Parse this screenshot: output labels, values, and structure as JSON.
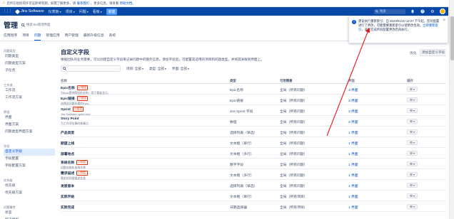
{
  "banner": {
    "text": "您所在组织的许可证即将到期，如需了解更多，请",
    "link1": "联系我们",
    "text2": "。更多信息，请查看",
    "link2": "帮助文档。"
  },
  "nav": {
    "brand": "Jira Software",
    "menus": [
      {
        "label": "仪表板"
      },
      {
        "label": "项目"
      },
      {
        "label": "问题"
      },
      {
        "label": "看板"
      }
    ],
    "create_label": "新建",
    "search_placeholder": "搜索"
  },
  "admin": {
    "title": "管理",
    "search_placeholder": "搜索Jira管理界面",
    "tabs": [
      {
        "label": "应用程序"
      },
      {
        "label": "项目"
      },
      {
        "label": "问题"
      },
      {
        "label": "管理应用"
      },
      {
        "label": "用户管理"
      },
      {
        "label": "最新升级信息"
      },
      {
        "label": "系统"
      }
    ]
  },
  "sidebar": {
    "groups": [
      {
        "heading": "问题类型",
        "items": [
          {
            "label": "问题类型"
          },
          {
            "label": "问题类型方案"
          },
          {
            "label": "子任务"
          }
        ]
      },
      {
        "heading": "工作流",
        "items": [
          {
            "label": "工作流"
          },
          {
            "label": "工作流方案"
          }
        ]
      },
      {
        "heading": "界面",
        "items": [
          {
            "label": "界面"
          },
          {
            "label": "界面方案"
          },
          {
            "label": "问题类型界面方案"
          }
        ]
      },
      {
        "heading": "字段",
        "items": [
          {
            "label": "自定义字段",
            "active": true
          },
          {
            "label": "字段配置"
          },
          {
            "label": "字段配置方案"
          }
        ]
      },
      {
        "heading": "优先级",
        "items": [
          {
            "label": "优先级"
          },
          {
            "label": "优先级方案"
          }
        ]
      },
      {
        "heading": "问题属性",
        "items": [
          {
            "label": "状态"
          },
          {
            "label": "解决结果"
          }
        ]
      }
    ]
  },
  "page": {
    "heading": "自定义字段",
    "description": "根据团队的业务需要，可以创建自定义字段来记录问题中的额外信息。添加字段后，可配置其适用的项目和问题类型，并将其关联到界面上。",
    "optimize_label": "优化",
    "add_label": "添加自定义字段",
    "filters": [
      {
        "label": "项目: 全部"
      },
      {
        "label": "类型: 全部"
      },
      {
        "label": "界面: 全部"
      }
    ]
  },
  "fields": {
    "columns": {
      "name": "名称",
      "type": "类型",
      "context": "可用情景",
      "screens": "界面",
      "actions": "操作"
    },
    "rows": [
      {
        "name": "Epic名称",
        "tag": "已锁定",
        "description": "为Epic提供简短的名称，用于看板显示。",
        "type": "Epic名称",
        "context": "全局（所有问题）",
        "screens": "3 界面"
      },
      {
        "name": "Epic链接",
        "tag": "已锁定",
        "description": "选择此问题所属的Epic。",
        "type": "Epic链接",
        "context": "全局（所有问题）",
        "screens": "3 界面"
      },
      {
        "name": "Sprint",
        "tag": "已锁定",
        "description": "Jira Software sprint field",
        "type": "Jira Sprint 字段",
        "context": "全局（所有问题）",
        "screens": "3 界面"
      },
      {
        "name": "Story Point",
        "description": "为工作项估算的故事点",
        "type": "数值",
        "context": "全局（所有问题）",
        "screens": "3 界面"
      },
      {
        "name": "产品类型",
        "type": "选择列表（单选）",
        "context": "全局（所有问题）",
        "screens": "1 界面"
      },
      {
        "name": "期望上线",
        "type": "文本框（单行）",
        "context": "全局（所有问题）",
        "screens": "1 界面"
      },
      {
        "name": "部署地点",
        "type": "文本框（多行）",
        "context": "全局（所有问题）",
        "screens": "1 界面"
      },
      {
        "name": "系统名称",
        "tag": "已锁定",
        "description": "问题关联的系统名称",
        "type": "数字字段",
        "context": "全局（所有问题）",
        "screens": "1 界面"
      },
      {
        "name": "需求描述",
        "tag": "已锁定",
        "description": "需求的详细描述信息",
        "type": "文本框（多行）",
        "context": "全局（所有问题）",
        "screens": "1 界面"
      },
      {
        "name": "发版版本",
        "type": "选择列表（单选）",
        "context": "全局（所有问题）",
        "screens": "1 界面"
      },
      {
        "name": "实际开始",
        "type": "文本框（单行）",
        "context": "全局（所有项目）",
        "screens": "1 界面"
      },
      {
        "name": "实际完成",
        "type": "日期选择器",
        "context": "全局（所有项目）",
        "screens": "1 界面"
      }
    ]
  },
  "notice": {
    "text": "建议执行重新索引：自 2023/01/10 12:27 下午起，您对配置进行了更改，可能需要重新索引以使更改生效。",
    "link": "立即重新索引",
    "text2": "，或在完成所有配置更改后再执行。"
  },
  "colors": {
    "nav": "#0747a6",
    "accent": "#0052cc",
    "locked_lozenge": "#de350b",
    "annotation": "#e5161b"
  }
}
